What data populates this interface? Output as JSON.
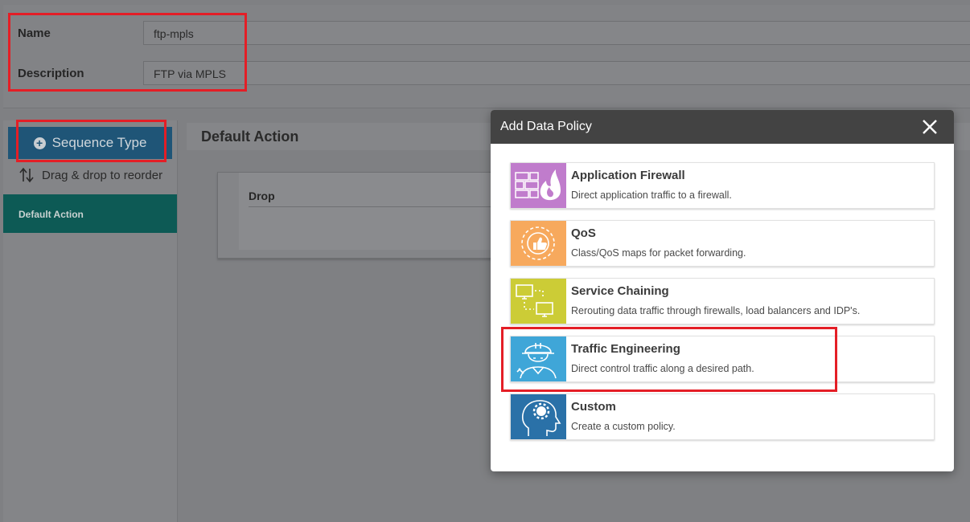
{
  "form": {
    "name_label": "Name",
    "name_value": "ftp-mpls",
    "description_label": "Description",
    "description_value": "FTP via MPLS"
  },
  "sidebar": {
    "sequence_type_label": "Sequence Type",
    "drag_hint": "Drag & drop to reorder",
    "items": [
      {
        "label": "Default Action"
      }
    ]
  },
  "main": {
    "section_title": "Default Action",
    "action_label": "Drop"
  },
  "modal": {
    "title": "Add Data Policy",
    "options": [
      {
        "title": "Application Firewall",
        "description": "Direct application traffic to a firewall.",
        "icon": "firewall-icon",
        "color": "#c07ccc"
      },
      {
        "title": "QoS",
        "description": "Class/QoS maps for packet forwarding.",
        "icon": "qos-thumbs-up-icon",
        "color": "#f7a95d"
      },
      {
        "title": "Service Chaining",
        "description": "Rerouting data traffic through firewalls, load balancers and IDP's.",
        "icon": "service-chain-monitors-icon",
        "color": "#cccc36"
      },
      {
        "title": "Traffic Engineering",
        "description": "Direct control traffic along a desired path.",
        "icon": "engineer-icon",
        "color": "#3fa6d8"
      },
      {
        "title": "Custom",
        "description": "Create a custom policy.",
        "icon": "head-gear-icon",
        "color": "#2a71a8"
      }
    ]
  },
  "colors": {
    "highlight": "#e41e26",
    "modal_header": "#434343",
    "sequence_button": "#1f5577",
    "default_action_item": "#0d5a55"
  }
}
